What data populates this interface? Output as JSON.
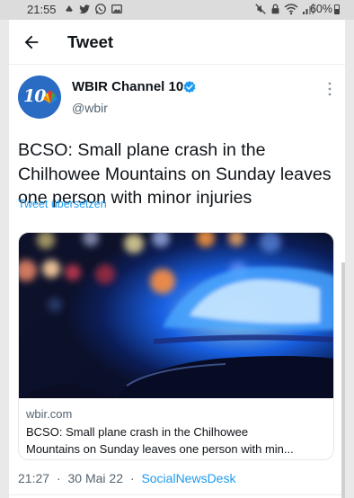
{
  "status_bar": {
    "time": "21:55",
    "battery": "60%"
  },
  "header": {
    "title": "Tweet"
  },
  "tweet": {
    "author": {
      "display_name": "WBIR Channel 10",
      "handle": "@wbir",
      "avatar_text": "10"
    },
    "text": "BCSO: Small plane crash in the Chilhowee Mountains on Sunday leaves one person with minor injuries",
    "translate_label": "Tweet übersetzen",
    "card": {
      "domain": "wbir.com",
      "title_line1": "BCSO: Small plane crash in the Chilhowee",
      "title_line2": "Mountains on Sunday leaves one person with min..."
    },
    "meta": {
      "time": "21:27",
      "date": "30 Mai 22",
      "separator": "·",
      "source": "SocialNewsDesk"
    }
  },
  "colors": {
    "accent": "#1d9bf0",
    "text": "#0f1419",
    "secondary": "#536471"
  },
  "icons": [
    "back-arrow-icon",
    "verified-badge-icon",
    "more-vert-icon",
    "twitter-icon",
    "whatsapp-icon",
    "gallery-icon",
    "mute-icon",
    "lock-icon",
    "wifi-icon",
    "signal-icon"
  ]
}
